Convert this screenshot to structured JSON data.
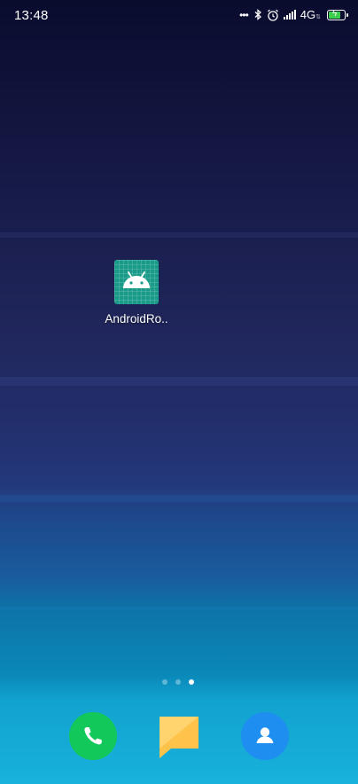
{
  "status_bar": {
    "time": "13:48",
    "network": "4G",
    "icons": [
      "more-dots-icon",
      "bluetooth-icon",
      "alarm-icon",
      "signal-icon",
      "battery-charging-icon"
    ],
    "battery_color": "#3ccf4e"
  },
  "home": {
    "apps": [
      {
        "label": "AndroidRo..",
        "icon": "android-app-icon",
        "icon_color": "#1a9b8a"
      }
    ],
    "pager": {
      "pages": 3,
      "active_page": 3
    }
  },
  "dock": {
    "items": [
      {
        "name": "phone",
        "icon": "phone-icon",
        "color": "#12c85a"
      },
      {
        "name": "messages",
        "icon": "messages-icon",
        "color": "#ffc24a"
      },
      {
        "name": "contacts",
        "icon": "contacts-icon",
        "color": "#1e8ef0"
      }
    ]
  }
}
